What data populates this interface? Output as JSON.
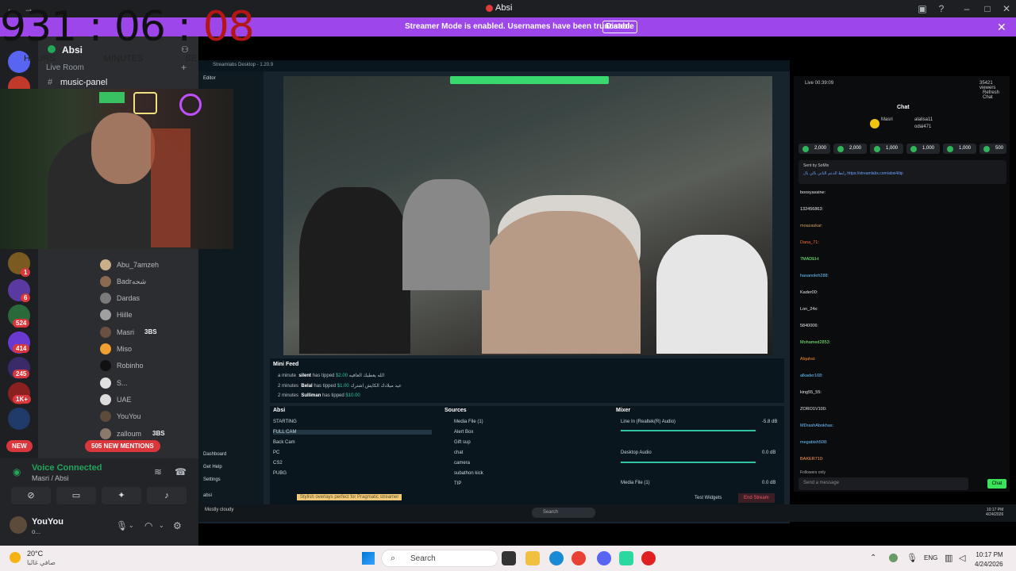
{
  "window": {
    "title": "Absi"
  },
  "banner": {
    "message": "Streamer Mode is enabled. Usernames have been truncated.",
    "disable_label": "Disable"
  },
  "overlay_timer": {
    "h": "931",
    "m": "06",
    "s": "08",
    "labels": [
      "HOURS",
      "MINUTES",
      "SE"
    ]
  },
  "guilds": [
    {
      "badge": "1"
    },
    {
      "badge": "6"
    },
    {
      "badge": "524"
    },
    {
      "badge": "414"
    },
    {
      "badge": "245"
    },
    {
      "badge": "1K+"
    }
  ],
  "server": {
    "name": "Absi"
  },
  "channels": {
    "live_room_header": "Live Room",
    "music_panel": "music-panel"
  },
  "members": [
    {
      "name": "Abu_7amzeh",
      "tag": ""
    },
    {
      "name": "Badrشحه",
      "tag": ""
    },
    {
      "name": "Dardas",
      "tag": ""
    },
    {
      "name": "Hiille",
      "tag": ""
    },
    {
      "name": "Masri",
      "tag": "3BS"
    },
    {
      "name": "Miso",
      "tag": ""
    },
    {
      "name": "Robinho",
      "tag": ""
    },
    {
      "name": "S...",
      "tag": ""
    },
    {
      "name": "UAE",
      "tag": ""
    },
    {
      "name": "YouYou",
      "tag": ""
    },
    {
      "name": "zalloum",
      "tag": "3BS"
    }
  ],
  "pills": {
    "new": "NEW",
    "mentions": "505 NEW MENTIONS"
  },
  "voice": {
    "status": "Voice Connected",
    "channel": "Masri / Absi"
  },
  "user": {
    "name": "YouYou",
    "status": "o..."
  },
  "streamlabs": {
    "title": "Streamlabs Desktop - 1.20.9",
    "sidebar": [
      "Editor",
      "Dashboard",
      "Get Help",
      "Settings",
      "absi"
    ],
    "feed_title": "Mini Feed",
    "feed": [
      {
        "time": "a minute",
        "user": "silent",
        "text": "has tipped",
        "amount": "$2.00",
        "msg": "الله يعطيك العافيه"
      },
      {
        "time": "2 minutes",
        "user": "Belal",
        "text": "has tipped",
        "amount": "$1.00",
        "msg": "عيد ميلادك الكايش اشترك"
      },
      {
        "time": "2 minutes",
        "user": "Sulliman",
        "text": "has tipped",
        "amount": "$10.00",
        "msg": ""
      }
    ],
    "scenes_title": "Absi",
    "scenes": [
      "STARTING",
      "FULL CAM",
      "Back Cam",
      "PC",
      "CS2",
      "PUBG"
    ],
    "sources_title": "Sources",
    "sources": [
      "Media File (1)",
      "Alert Box",
      "Gift sup",
      "chat",
      "camera",
      "subathon kick",
      "TIP"
    ],
    "mixer_title": "Mixer",
    "mixer": [
      {
        "name": "Line In (Realtek(R) Audio)",
        "db": "-5.8 dB"
      },
      {
        "name": "Desktop Audio",
        "db": "0.0 dB"
      },
      {
        "name": "Media File (1)",
        "db": "0.0 dB"
      }
    ],
    "promo": "Stylish overlays perfect for Pragmatic streamer",
    "test_widgets": "Test Widgets",
    "end_stream": "End Stream",
    "weather": "Mostly cloudy",
    "inner_search": "Search",
    "inner_time": "10:17 PM",
    "inner_date": "4/24/2026"
  },
  "chat": {
    "live": "Live 00:39:09",
    "viewers": "35421 viewers",
    "refresh": "Refresh Chat",
    "tab": "Chat",
    "top_users": [
      "Masri",
      "alalisa11",
      "odai471"
    ],
    "chips": [
      "2,000",
      "2,000",
      "1,000",
      "1,000",
      "1,000",
      "500"
    ],
    "pinned_by": "Sent by SoMix",
    "pinned_text": "رابط الدعم الثاني بالي بال https://streamlabs.com/absi4/tip",
    "messages": [
      {
        "user": "boosyassine:",
        "color": "#e8e8e8"
      },
      {
        "user": "132456863:",
        "color": "#e8e8e8"
      },
      {
        "user": "moazaskar:",
        "color": "#d0a060"
      },
      {
        "user": "Dana_71:",
        "color": "#ff6a3a"
      },
      {
        "user": "7MADEH:",
        "color": "#7fff7f"
      },
      {
        "user": "hasanoleh288:",
        "color": "#6ac3ff"
      },
      {
        "user": "Kader00:",
        "color": "#e8e8e8"
      },
      {
        "user": "Lon_24x:",
        "color": "#e8e8e8"
      },
      {
        "user": "5840006:",
        "color": "#e8e8e8"
      },
      {
        "user": "Mohamed2853:",
        "color": "#7fff7f"
      },
      {
        "user": "Alqahsi:",
        "color": "#ff8a2a"
      },
      {
        "user": "alkader168:",
        "color": "#6ac3ff"
      },
      {
        "user": "king55_55:",
        "color": "#e8e8e8"
      },
      {
        "user": "ZORO1V100:",
        "color": "#e8e8e8"
      },
      {
        "user": "MDrashAbokhas:",
        "color": "#6ac3ff"
      },
      {
        "user": "megabish508:",
        "color": "#6ac3ff"
      },
      {
        "user": "BAKER710:",
        "color": "#ff9a4a"
      }
    ],
    "followers_only": "Followers only",
    "input_placeholder": "Send a message",
    "send_label": "Chat"
  },
  "taskbar": {
    "temp": "20°C",
    "condition": "صافي غالبا",
    "search": "Search",
    "lang": "ENG",
    "time": "10:17 PM",
    "date": "4/24/2026"
  }
}
